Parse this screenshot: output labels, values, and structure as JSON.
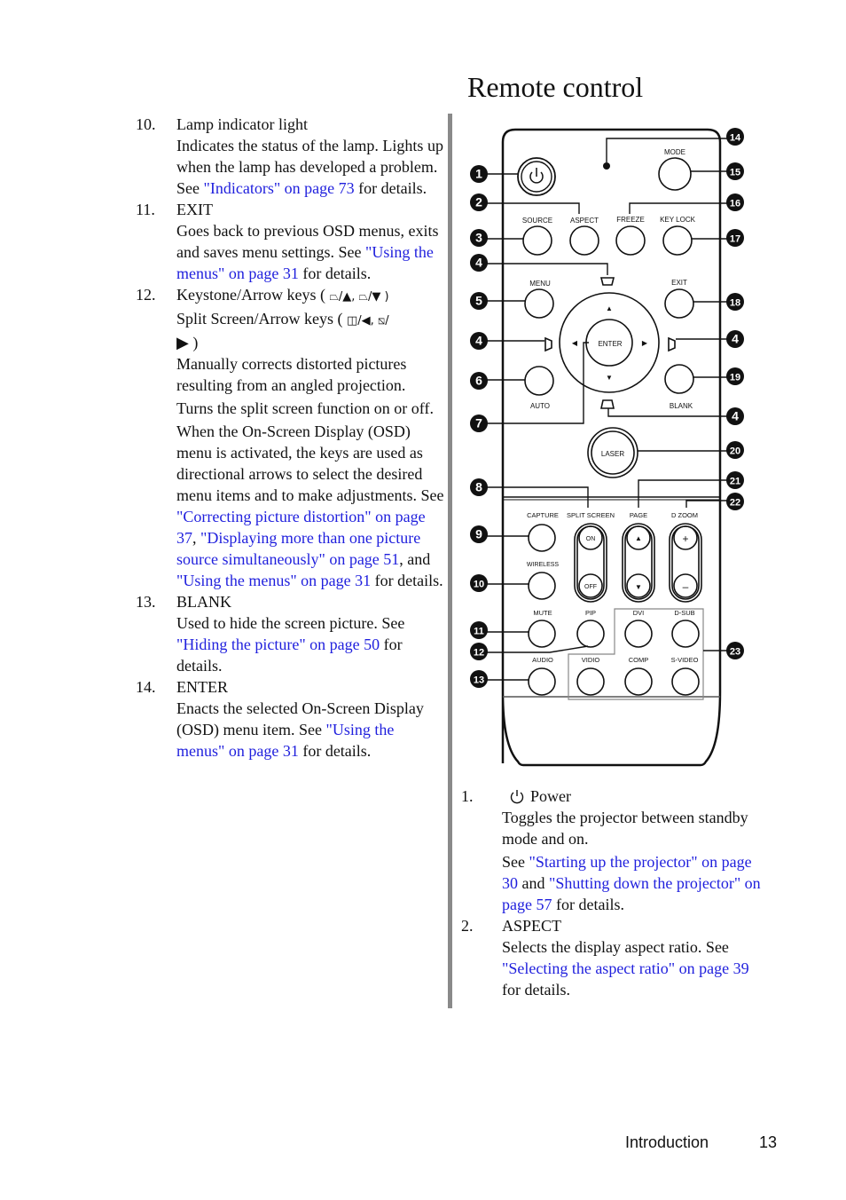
{
  "page": {
    "title": "Remote control",
    "footer_section": "Introduction",
    "footer_page": "13"
  },
  "left_items": [
    {
      "num": "10.",
      "head": "Lamp indicator light",
      "paras": [
        [
          {
            "t": "Indicates the status of the lamp. Lights up when the lamp has developed a problem. See "
          },
          {
            "l": "\"Indicators\" on page 73"
          },
          {
            "t": " for details."
          }
        ]
      ]
    },
    {
      "num": "11.",
      "head": "EXIT",
      "paras": [
        [
          {
            "t": "Goes back to previous OSD menus, exits and saves menu settings. See "
          },
          {
            "l": "\"Using the menus\" on page 31"
          },
          {
            "t": " for details."
          }
        ]
      ]
    },
    {
      "num": "12.",
      "head_line1": "Keystone/Arrow keys (",
      "head_line1_syms": [
        "⏢",
        "/▲, ",
        "⏢",
        "/▼ )"
      ],
      "head_line2": "Split Screen/Arrow keys (",
      "head_line2_syms": [
        "◫",
        "/◀, ",
        "⧅",
        "/"
      ],
      "head_line3": "▶ )",
      "paras": [
        [
          {
            "t": "Manually corrects distorted pictures resulting from an angled projection."
          }
        ],
        [
          {
            "t": "Turns the split screen function on or off."
          }
        ],
        [
          {
            "t": "When the On-Screen Display (OSD) menu is activated, the keys are used as directional arrows to select the desired menu items and to make adjustments. See "
          },
          {
            "l": "\"Correcting picture distortion\" on page 37"
          },
          {
            "t": ", "
          },
          {
            "l": "\"Displaying more than one picture source simultaneously\" on page 51"
          },
          {
            "t": ", and "
          },
          {
            "l": "\"Using the menus\" on page 31"
          },
          {
            "t": " for details."
          }
        ]
      ]
    },
    {
      "num": "13.",
      "head": "BLANK",
      "paras": [
        [
          {
            "t": "Used to hide the screen picture. See "
          },
          {
            "l": "\"Hiding the picture\" on page 50"
          },
          {
            "t": " for details."
          }
        ]
      ]
    },
    {
      "num": "14.",
      "head": "ENTER",
      "paras": [
        [
          {
            "t": "Enacts the selected On-Screen Display (OSD) menu item. See "
          },
          {
            "l": "\"Using the menus\" on page 31"
          },
          {
            "t": " for details."
          }
        ]
      ]
    }
  ],
  "right_items": [
    {
      "num": "1.",
      "head": "Power",
      "head_icon": "power-icon",
      "paras": [
        [
          {
            "t": "Toggles the projector between standby mode and on."
          }
        ],
        [
          {
            "t": "See "
          },
          {
            "l": "\"Starting up the projector\" on page 30"
          },
          {
            "t": " and "
          },
          {
            "l": "\"Shutting down the projector\" on page 57"
          },
          {
            "t": " for details."
          }
        ]
      ]
    },
    {
      "num": "2.",
      "head": "ASPECT",
      "paras": [
        [
          {
            "t": "Selects the display aspect ratio. See "
          },
          {
            "l": "\"Selecting the aspect ratio\" on page 39"
          },
          {
            "t": " for details."
          }
        ]
      ]
    }
  ],
  "remote": {
    "buttons": {
      "mode": "MODE",
      "source": "SOURCE",
      "aspect": "ASPECT",
      "freeze": "FREEZE",
      "key_lock": "KEY LOCK",
      "menu": "MENU",
      "exit": "EXIT",
      "enter": "ENTER",
      "auto": "AUTO",
      "blank": "BLANK",
      "laser": "LASER",
      "capture": "CAPTURE",
      "split_screen": "SPLIT SCREEN",
      "page": "PAGE",
      "d_zoom": "D ZOOM",
      "on": "ON",
      "off": "OFF",
      "wireless": "WIRELESS",
      "mute": "MUTE",
      "pip": "PIP",
      "dvi": "DVI",
      "d_sub": "D-SUB",
      "audio": "AUDIO",
      "vidio": "VIDIO",
      "comp": "COMP",
      "s_video": "S-VIDEO",
      "plus": "+",
      "minus": "–",
      "up": "▲",
      "down": "▼",
      "left": "◀",
      "right": "▶"
    },
    "callouts_left": [
      "1",
      "2",
      "3",
      "4",
      "5",
      "4",
      "6",
      "7",
      "8",
      "9",
      "10",
      "11",
      "12",
      "13"
    ],
    "callouts_right": [
      "14",
      "15",
      "16",
      "17",
      "18",
      "4",
      "19",
      "4",
      "20",
      "21",
      "22",
      "23"
    ]
  }
}
